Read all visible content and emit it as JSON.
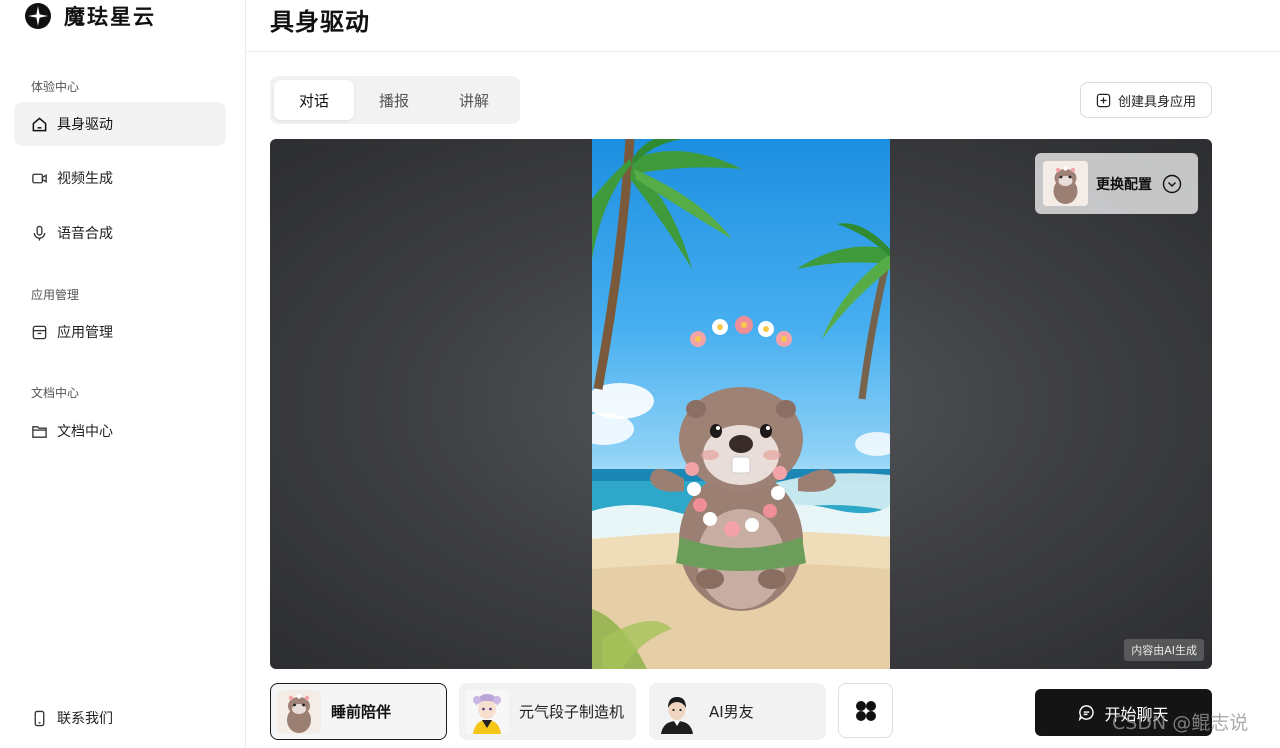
{
  "brand": {
    "name": "魔珐星云",
    "logo_icon": "brand-logo-icon"
  },
  "sidebar": {
    "sections": [
      {
        "label": "体验中心"
      },
      {
        "label": "应用管理"
      },
      {
        "label": "文档中心"
      }
    ],
    "items": [
      {
        "label": "具身驱动",
        "icon": "home-icon",
        "active": true
      },
      {
        "label": "视频生成",
        "icon": "video-camera-icon"
      },
      {
        "label": "语音合成",
        "icon": "microphone-icon"
      },
      {
        "label": "应用管理",
        "icon": "archive-box-icon"
      },
      {
        "label": "文档中心",
        "icon": "folder-icon"
      }
    ],
    "contact": {
      "label": "联系我们",
      "icon": "phone-icon"
    }
  },
  "header": {
    "title": "具身驱动"
  },
  "tabs": [
    {
      "label": "对话",
      "active": true
    },
    {
      "label": "播报"
    },
    {
      "label": "讲解"
    }
  ],
  "toolbar": {
    "create_label": "创建具身应用",
    "create_icon": "plus-square-icon"
  },
  "stage": {
    "config_label": "更换配置",
    "config_icon": "chevron-down-circle-icon",
    "ai_badge": "内容由AI生成"
  },
  "personas": [
    {
      "label": "睡前陪伴",
      "active": true
    },
    {
      "label": "元气段子制造机"
    },
    {
      "label": "AI男友"
    }
  ],
  "more_icon": "four-petal-grid-icon",
  "start_button": {
    "label": "开始聊天",
    "icon": "chat-bubble-icon"
  },
  "watermark": "CSDN @鲲志说",
  "colors": {
    "primary_dark": "#141414",
    "stage_bg": "#3c3d40",
    "active_nav_bg": "#f3f3f3",
    "tab_bg": "#f2f2f3"
  }
}
